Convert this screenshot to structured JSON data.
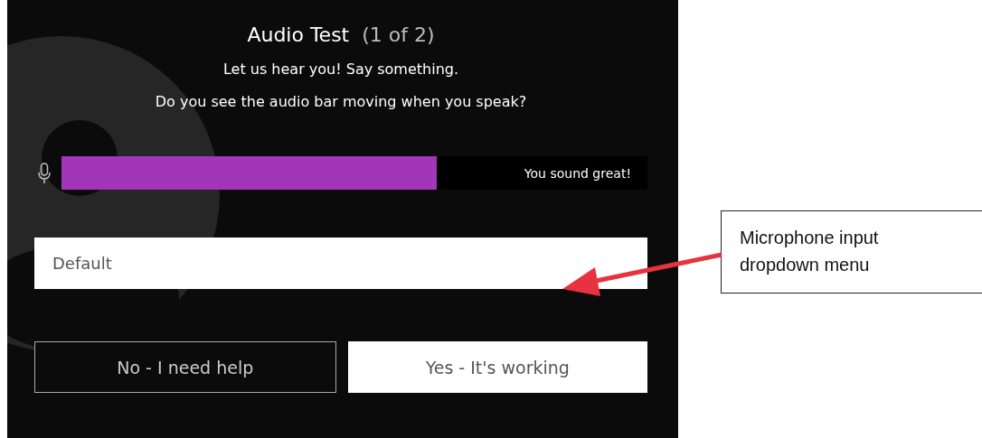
{
  "dialog": {
    "title": "Audio Test",
    "step": "(1 of 2)",
    "prompt_lines": [
      "Let us hear you! Say something.",
      "Do you see the audio bar moving when you speak?"
    ],
    "meter": {
      "level": 0.64,
      "status": "You sound great!"
    },
    "microphone_select": {
      "value": "Default"
    },
    "buttons": [
      {
        "label": "No - I need help",
        "kind": "outline"
      },
      {
        "label": "Yes - It's working",
        "kind": "filled"
      }
    ]
  },
  "callout": {
    "lines": [
      "Microphone input",
      "dropdown menu"
    ]
  }
}
